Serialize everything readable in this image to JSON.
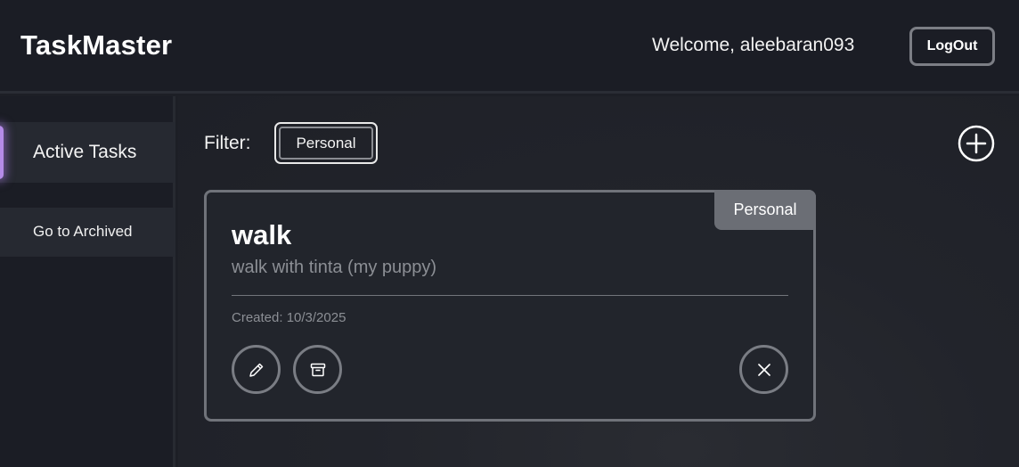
{
  "header": {
    "app_title": "TaskMaster",
    "welcome": "Welcome, aleebaran093",
    "logout_label": "LogOut"
  },
  "sidebar": {
    "items": [
      {
        "label": "Active Tasks",
        "active": true
      },
      {
        "label": "Go to Archived",
        "active": false
      }
    ],
    "accent_color": "#b58be8"
  },
  "main": {
    "filter_label": "Filter:",
    "filter_value": "Personal",
    "add_icon": "plus-circle-icon"
  },
  "tasks": [
    {
      "category": "Personal",
      "title": "walk",
      "description": "walk with tinta (my puppy)",
      "created": "Created: 10/3/2025",
      "actions": [
        "pencil-icon",
        "archive-icon",
        "close-icon"
      ]
    }
  ]
}
